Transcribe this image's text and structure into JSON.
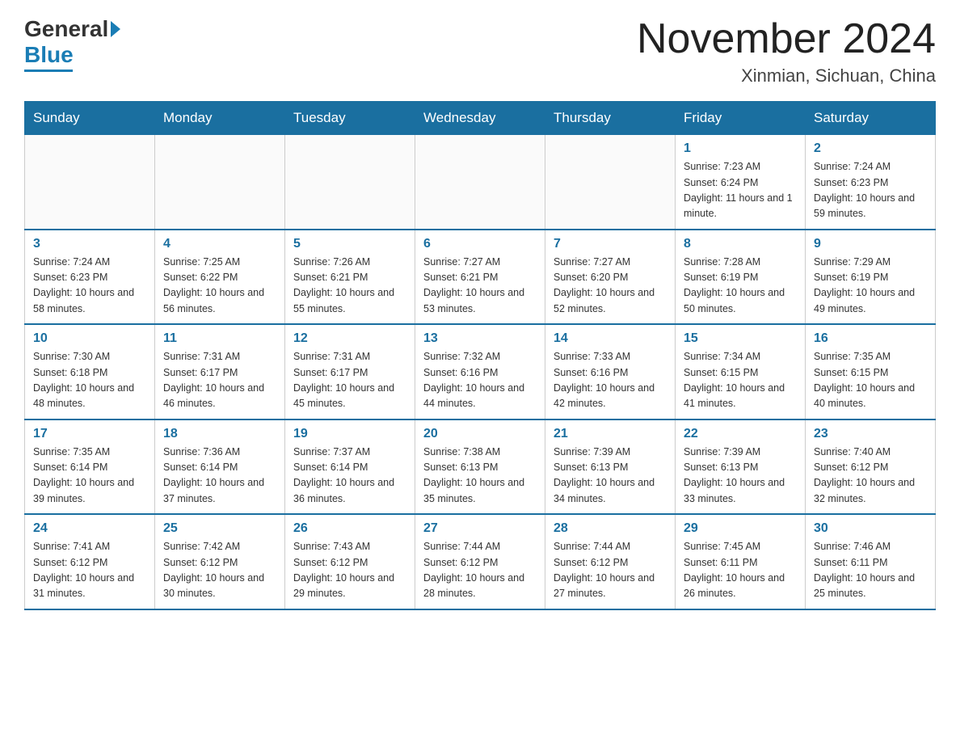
{
  "header": {
    "logo_general": "General",
    "logo_blue": "Blue",
    "title": "November 2024",
    "subtitle": "Xinmian, Sichuan, China"
  },
  "days_of_week": [
    "Sunday",
    "Monday",
    "Tuesday",
    "Wednesday",
    "Thursday",
    "Friday",
    "Saturday"
  ],
  "weeks": [
    [
      {
        "day": "",
        "info": ""
      },
      {
        "day": "",
        "info": ""
      },
      {
        "day": "",
        "info": ""
      },
      {
        "day": "",
        "info": ""
      },
      {
        "day": "",
        "info": ""
      },
      {
        "day": "1",
        "info": "Sunrise: 7:23 AM\nSunset: 6:24 PM\nDaylight: 11 hours and 1 minute."
      },
      {
        "day": "2",
        "info": "Sunrise: 7:24 AM\nSunset: 6:23 PM\nDaylight: 10 hours and 59 minutes."
      }
    ],
    [
      {
        "day": "3",
        "info": "Sunrise: 7:24 AM\nSunset: 6:23 PM\nDaylight: 10 hours and 58 minutes."
      },
      {
        "day": "4",
        "info": "Sunrise: 7:25 AM\nSunset: 6:22 PM\nDaylight: 10 hours and 56 minutes."
      },
      {
        "day": "5",
        "info": "Sunrise: 7:26 AM\nSunset: 6:21 PM\nDaylight: 10 hours and 55 minutes."
      },
      {
        "day": "6",
        "info": "Sunrise: 7:27 AM\nSunset: 6:21 PM\nDaylight: 10 hours and 53 minutes."
      },
      {
        "day": "7",
        "info": "Sunrise: 7:27 AM\nSunset: 6:20 PM\nDaylight: 10 hours and 52 minutes."
      },
      {
        "day": "8",
        "info": "Sunrise: 7:28 AM\nSunset: 6:19 PM\nDaylight: 10 hours and 50 minutes."
      },
      {
        "day": "9",
        "info": "Sunrise: 7:29 AM\nSunset: 6:19 PM\nDaylight: 10 hours and 49 minutes."
      }
    ],
    [
      {
        "day": "10",
        "info": "Sunrise: 7:30 AM\nSunset: 6:18 PM\nDaylight: 10 hours and 48 minutes."
      },
      {
        "day": "11",
        "info": "Sunrise: 7:31 AM\nSunset: 6:17 PM\nDaylight: 10 hours and 46 minutes."
      },
      {
        "day": "12",
        "info": "Sunrise: 7:31 AM\nSunset: 6:17 PM\nDaylight: 10 hours and 45 minutes."
      },
      {
        "day": "13",
        "info": "Sunrise: 7:32 AM\nSunset: 6:16 PM\nDaylight: 10 hours and 44 minutes."
      },
      {
        "day": "14",
        "info": "Sunrise: 7:33 AM\nSunset: 6:16 PM\nDaylight: 10 hours and 42 minutes."
      },
      {
        "day": "15",
        "info": "Sunrise: 7:34 AM\nSunset: 6:15 PM\nDaylight: 10 hours and 41 minutes."
      },
      {
        "day": "16",
        "info": "Sunrise: 7:35 AM\nSunset: 6:15 PM\nDaylight: 10 hours and 40 minutes."
      }
    ],
    [
      {
        "day": "17",
        "info": "Sunrise: 7:35 AM\nSunset: 6:14 PM\nDaylight: 10 hours and 39 minutes."
      },
      {
        "day": "18",
        "info": "Sunrise: 7:36 AM\nSunset: 6:14 PM\nDaylight: 10 hours and 37 minutes."
      },
      {
        "day": "19",
        "info": "Sunrise: 7:37 AM\nSunset: 6:14 PM\nDaylight: 10 hours and 36 minutes."
      },
      {
        "day": "20",
        "info": "Sunrise: 7:38 AM\nSunset: 6:13 PM\nDaylight: 10 hours and 35 minutes."
      },
      {
        "day": "21",
        "info": "Sunrise: 7:39 AM\nSunset: 6:13 PM\nDaylight: 10 hours and 34 minutes."
      },
      {
        "day": "22",
        "info": "Sunrise: 7:39 AM\nSunset: 6:13 PM\nDaylight: 10 hours and 33 minutes."
      },
      {
        "day": "23",
        "info": "Sunrise: 7:40 AM\nSunset: 6:12 PM\nDaylight: 10 hours and 32 minutes."
      }
    ],
    [
      {
        "day": "24",
        "info": "Sunrise: 7:41 AM\nSunset: 6:12 PM\nDaylight: 10 hours and 31 minutes."
      },
      {
        "day": "25",
        "info": "Sunrise: 7:42 AM\nSunset: 6:12 PM\nDaylight: 10 hours and 30 minutes."
      },
      {
        "day": "26",
        "info": "Sunrise: 7:43 AM\nSunset: 6:12 PM\nDaylight: 10 hours and 29 minutes."
      },
      {
        "day": "27",
        "info": "Sunrise: 7:44 AM\nSunset: 6:12 PM\nDaylight: 10 hours and 28 minutes."
      },
      {
        "day": "28",
        "info": "Sunrise: 7:44 AM\nSunset: 6:12 PM\nDaylight: 10 hours and 27 minutes."
      },
      {
        "day": "29",
        "info": "Sunrise: 7:45 AM\nSunset: 6:11 PM\nDaylight: 10 hours and 26 minutes."
      },
      {
        "day": "30",
        "info": "Sunrise: 7:46 AM\nSunset: 6:11 PM\nDaylight: 10 hours and 25 minutes."
      }
    ]
  ]
}
